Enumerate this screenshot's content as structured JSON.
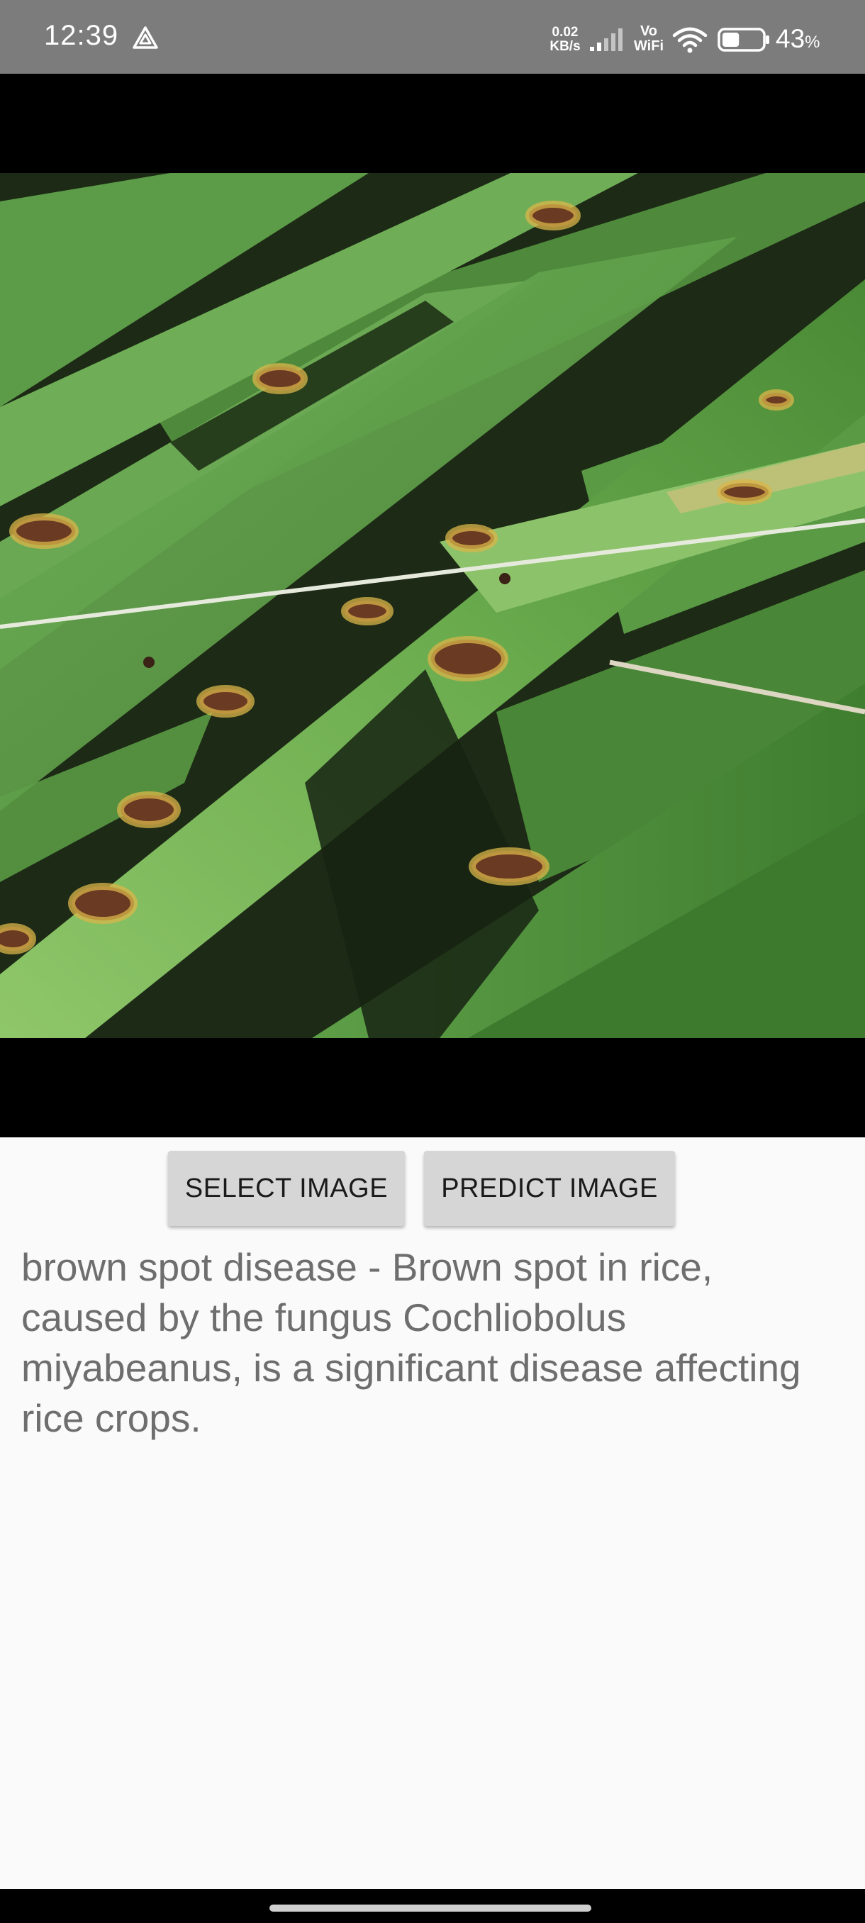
{
  "status_bar": {
    "time": "12:39",
    "net_speed_value": "0.02",
    "net_speed_unit": "KB/s",
    "vo": "Vo",
    "wifi_label": "WiFi",
    "battery_value": "43",
    "battery_pct_sign": "%",
    "battery_level": 0.43,
    "icons": [
      "alert-triangle-icon",
      "signal-icon",
      "wifi-icon",
      "battery-icon"
    ]
  },
  "main": {
    "image_icon": "rice-leaf-image"
  },
  "buttons": {
    "select_label": "SELECT IMAGE",
    "predict_label": "PREDICT IMAGE"
  },
  "result": {
    "text": "brown spot disease - Brown spot in rice, caused by the fungus Cochliobolus miyabeanus, is a significant disease affecting rice crops."
  },
  "colors": {
    "status_bar_bg": "#7c7c7c",
    "button_bg": "#d6d6d6",
    "result_text": "#6e6e6e",
    "page_bg": "#fafafa"
  }
}
